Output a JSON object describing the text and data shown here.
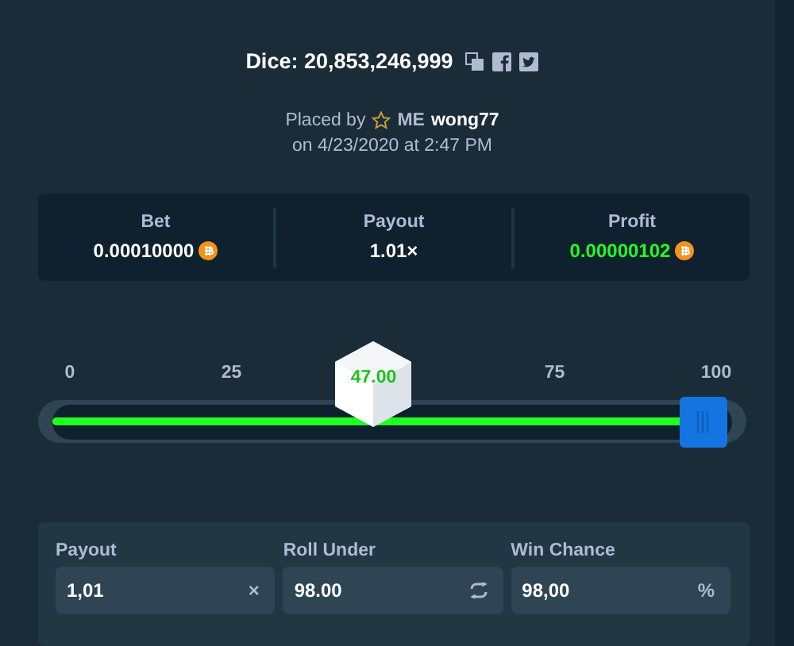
{
  "title": "Dice: 20,853,246,999",
  "placed": {
    "prefix": "Placed by",
    "rank": "ME",
    "username": "wong77",
    "date": "on 4/23/2020 at 2:47 PM"
  },
  "stats": [
    {
      "label": "Bet",
      "value": "0.00010000",
      "kind": "coin",
      "color": "#ffffff"
    },
    {
      "label": "Payout",
      "value": "1.01×",
      "kind": "plain",
      "color": "#ffffff"
    },
    {
      "label": "Profit",
      "value": "0.00000102",
      "kind": "coin",
      "color": "#1fff20"
    }
  ],
  "slider": {
    "level": 0.98,
    "ticks": [
      "0",
      "25",
      "75",
      "100"
    ],
    "dice": {
      "result": "47.00",
      "level": 0.47
    }
  },
  "fields": [
    {
      "label": "Payout",
      "value": "1,01",
      "kind": "suffix",
      "suffix": "×"
    },
    {
      "label": "Roll Under",
      "value": "98.00",
      "kind": "swap"
    },
    {
      "label": "Win Chance",
      "value": "98,00",
      "kind": "suffix",
      "suffix": "%"
    }
  ]
}
